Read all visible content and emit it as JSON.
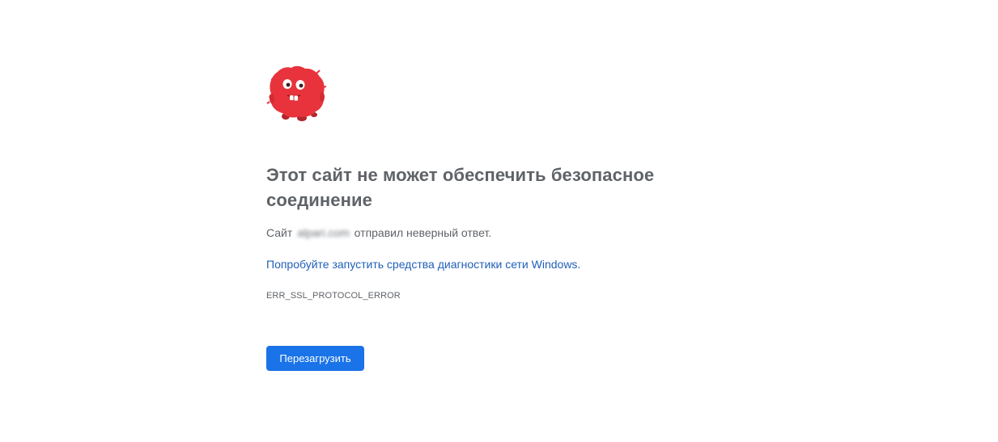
{
  "icons": {
    "mascot": "red-fuzzy-monster-icon"
  },
  "colors": {
    "mascot_red": "#e8333c",
    "heading": "#5f6368",
    "link": "#2160b8",
    "button_bg": "#1a73e8",
    "button_text": "#ffffff"
  },
  "error": {
    "heading": "Этот сайт не может обеспечить безопасное соединение",
    "desc_prefix": "Сайт",
    "domain": "alpari.com",
    "desc_suffix": "отправил неверный ответ.",
    "diagnostics_link": "Попробуйте запустить средства диагностики сети Windows.",
    "code": "ERR_SSL_PROTOCOL_ERROR",
    "reload_label": "Перезагрузить"
  }
}
